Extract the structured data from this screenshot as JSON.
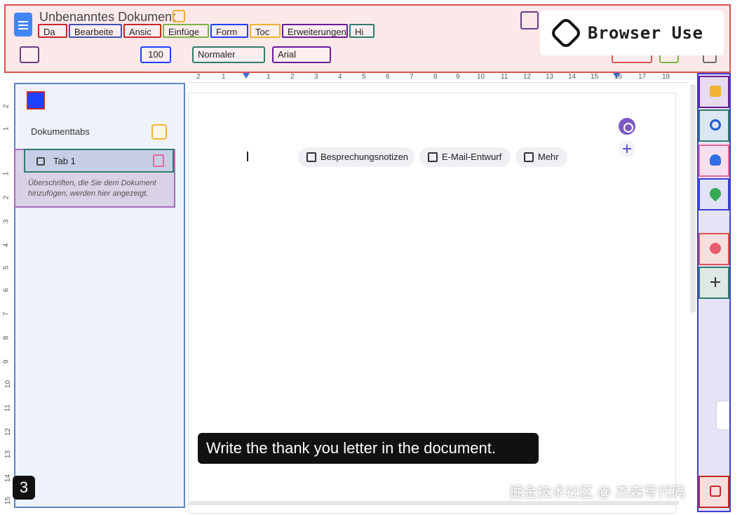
{
  "document": {
    "title": "Unbenanntes Dokument"
  },
  "menu": {
    "items": [
      "Da",
      "Bearbeite",
      "Ansic",
      "Einfüge",
      "Form",
      "Toc",
      "Erweiterungen",
      "Hi"
    ]
  },
  "toolbar": {
    "zoom": "100",
    "style": "Normaler",
    "font": "Arial"
  },
  "brand": {
    "name": "Browser Use"
  },
  "ruler": {
    "top_ticks": [
      "2",
      "1",
      "1",
      "2",
      "3",
      "4",
      "5",
      "6",
      "7",
      "8",
      "9",
      "10",
      "11",
      "12",
      "13",
      "14",
      "15",
      "16",
      "17",
      "18"
    ],
    "left_ticks": [
      "2",
      "1",
      "1",
      "2",
      "3",
      "4",
      "5",
      "6",
      "7",
      "8",
      "9",
      "10",
      "11",
      "12",
      "13",
      "14",
      "15"
    ]
  },
  "sidebar": {
    "title": "Dokumenttabs",
    "tab_label": "Tab 1",
    "hint": "Überschriften, die Sie dem Dokument hinzufügen, werden hier angezeigt."
  },
  "chips": {
    "meeting": "Besprechungsnotizen",
    "email": "E-Mail-Entwurf",
    "more": "Mehr"
  },
  "overlay": {
    "caption": "Write the thank you letter in the document.",
    "step": "3",
    "watermark": "掘金技术社区 @ 杰森写代码"
  },
  "colors": {
    "header_border": "#d9534f",
    "sidebar_bg": "#eef3fb",
    "accent_blue": "#4285f4",
    "right_bar_bg": "#e6e3f6"
  }
}
